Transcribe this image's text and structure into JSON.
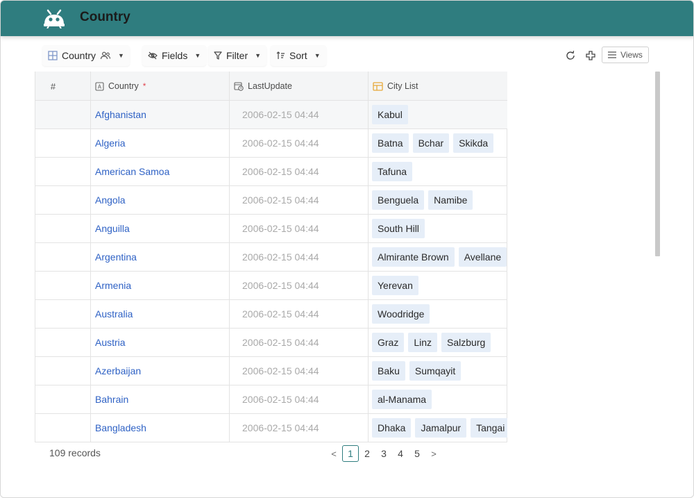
{
  "header": {
    "title": "Country"
  },
  "toolbar": {
    "view_label": "Country",
    "fields_label": "Fields",
    "filter_label": "Filter",
    "sort_label": "Sort",
    "views_label": "Views"
  },
  "columns": {
    "num": "#",
    "country": "Country",
    "required_mark": "*",
    "last_update": "LastUpdate",
    "city_list": "City List"
  },
  "rows": [
    {
      "country": "Afghanistan",
      "last_update": "2006-02-15 04:44",
      "cities": [
        "Kabul"
      ]
    },
    {
      "country": "Algeria",
      "last_update": "2006-02-15 04:44",
      "cities": [
        "Batna",
        "Bchar",
        "Skikda"
      ]
    },
    {
      "country": "American Samoa",
      "last_update": "2006-02-15 04:44",
      "cities": [
        "Tafuna"
      ]
    },
    {
      "country": "Angola",
      "last_update": "2006-02-15 04:44",
      "cities": [
        "Benguela",
        "Namibe"
      ]
    },
    {
      "country": "Anguilla",
      "last_update": "2006-02-15 04:44",
      "cities": [
        "South Hill"
      ]
    },
    {
      "country": "Argentina",
      "last_update": "2006-02-15 04:44",
      "cities": [
        "Almirante Brown",
        "Avellane"
      ]
    },
    {
      "country": "Armenia",
      "last_update": "2006-02-15 04:44",
      "cities": [
        "Yerevan"
      ]
    },
    {
      "country": "Australia",
      "last_update": "2006-02-15 04:44",
      "cities": [
        "Woodridge"
      ]
    },
    {
      "country": "Austria",
      "last_update": "2006-02-15 04:44",
      "cities": [
        "Graz",
        "Linz",
        "Salzburg"
      ]
    },
    {
      "country": "Azerbaijan",
      "last_update": "2006-02-15 04:44",
      "cities": [
        "Baku",
        "Sumqayit"
      ]
    },
    {
      "country": "Bahrain",
      "last_update": "2006-02-15 04:44",
      "cities": [
        "al-Manama"
      ]
    },
    {
      "country": "Bangladesh",
      "last_update": "2006-02-15 04:44",
      "cities": [
        "Dhaka",
        "Jamalpur",
        "Tangai"
      ]
    }
  ],
  "footer": {
    "record_count": "109 records"
  },
  "pagination": {
    "prev": "<",
    "next": ">",
    "pages": [
      "1",
      "2",
      "3",
      "4",
      "5"
    ],
    "current": "1"
  },
  "colors": {
    "header_bg": "#2f7d7f",
    "link": "#2f62c5",
    "chip_bg": "#e6eef8",
    "required": "#e0424e"
  },
  "icons": {
    "logo": "robot-logo-icon",
    "grid_view": "grid-view-icon",
    "collaborators": "users-icon",
    "fields": "eye-off-icon",
    "filter": "filter-icon",
    "sort": "sort-icon",
    "reload": "reload-icon",
    "add": "plus-icon",
    "views": "menu-icon"
  }
}
